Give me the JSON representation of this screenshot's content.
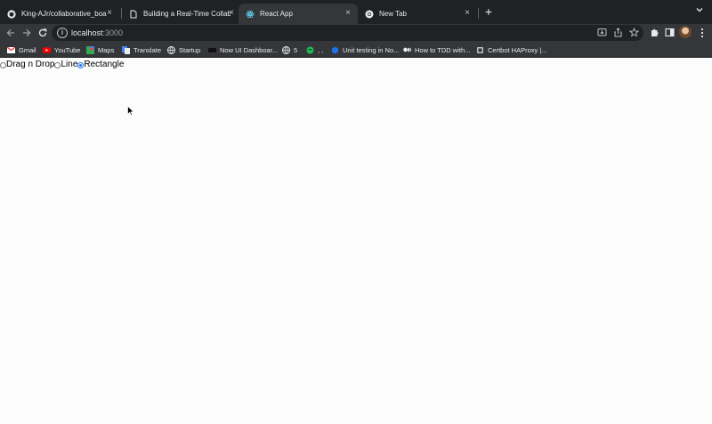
{
  "browser": {
    "tabs": [
      {
        "title": "King-AJr/collaborative_board",
        "icon": "github-icon"
      },
      {
        "title": "Building a Real-Time Collabora",
        "icon": "document-icon"
      },
      {
        "title": "React App",
        "icon": "react-icon"
      },
      {
        "title": "New Tab",
        "icon": "chrome-icon"
      }
    ],
    "new_tab_label": "+",
    "address": {
      "host": "localhost",
      "port": ":3000"
    },
    "bookmarks": [
      {
        "label": "Gmail",
        "icon": "gmail-icon"
      },
      {
        "label": "YouTube",
        "icon": "youtube-icon"
      },
      {
        "label": "Maps",
        "icon": "maps-icon"
      },
      {
        "label": "Translate",
        "icon": "translate-icon"
      },
      {
        "label": "Startup",
        "icon": "globe-icon"
      },
      {
        "label": "Now UI Dashboar...",
        "icon": "bookmark-icon"
      },
      {
        "label": "5",
        "icon": "globe-icon"
      },
      {
        "label": ", ,",
        "icon": "bookmark-icon"
      },
      {
        "label": "Unit testing in No...",
        "icon": "bookmark-icon"
      },
      {
        "label": "How to TDD with...",
        "icon": "medium-icon"
      },
      {
        "label": "Certbot HAProxy |...",
        "icon": "bookmark-icon"
      }
    ],
    "colors": {
      "frame": "#202124",
      "toolbar": "#35363a",
      "text": "#e8eaed",
      "accent": "#1a73e8"
    }
  },
  "app": {
    "tools": [
      {
        "label": "Drag n Drop",
        "checked": false
      },
      {
        "label": "Line",
        "checked": false
      },
      {
        "label": "Rectangle",
        "checked": true
      }
    ]
  }
}
